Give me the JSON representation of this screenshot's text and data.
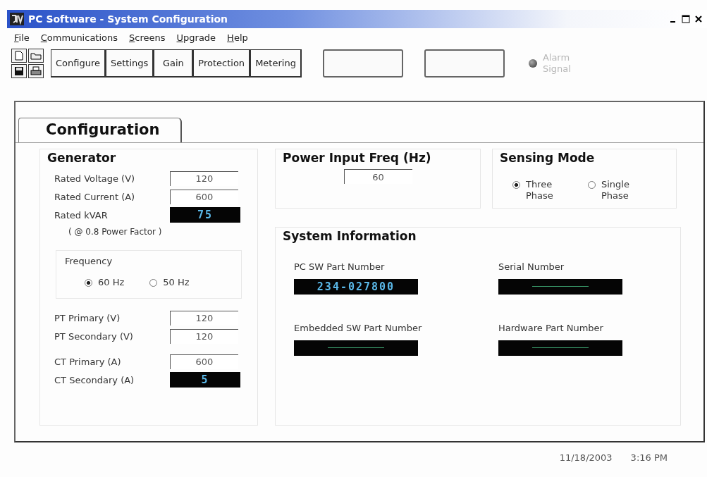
{
  "window": {
    "title": "PC Software - System Configuration"
  },
  "menu": [
    "File",
    "Communications",
    "Screens",
    "Upgrade",
    "Help"
  ],
  "nav_buttons": [
    "Configure",
    "Settings",
    "Gain",
    "Protection",
    "Metering"
  ],
  "action_buttons": [
    {
      "disabled": true
    },
    {
      "disabled": true
    }
  ],
  "alarm": {
    "label": "Alarm Signal",
    "disabled": true
  },
  "tab": {
    "label": "Configuration",
    "selected": true
  },
  "generator": {
    "title": "Generator",
    "fields": [
      {
        "label": "Rated Voltage (V)",
        "value": "120",
        "kind": "input"
      },
      {
        "label": "Rated Current (A)",
        "value": "600",
        "kind": "input"
      },
      {
        "label": "Rated kVAR",
        "value": "75",
        "kind": "display"
      }
    ],
    "note": "( @ 0.8 Power Factor )",
    "frequency": {
      "title": "Frequency",
      "options": [
        {
          "label": "60 Hz",
          "selected": true
        },
        {
          "label": "50 Hz",
          "selected": false
        }
      ]
    },
    "transformer_groups": [
      [
        {
          "label": "PT Primary (V)",
          "value": "120",
          "kind": "input"
        },
        {
          "label": "PT Secondary (V)",
          "value": "120",
          "kind": "input"
        }
      ],
      [
        {
          "label": "CT Primary (A)",
          "value": "600",
          "kind": "input"
        },
        {
          "label": "CT Secondary (A)",
          "value": "5",
          "kind": "display"
        }
      ]
    ]
  },
  "power_input": {
    "title": "Power Input Freq (Hz)",
    "value": "60"
  },
  "sensing_mode": {
    "title": "Sensing Mode",
    "options": [
      {
        "label": "Three Phase",
        "selected": true
      },
      {
        "label": "Single Phase",
        "selected": false
      }
    ]
  },
  "system_information": {
    "title": "System Information",
    "items": [
      {
        "label": "PC SW Part Number",
        "value": "234-027800"
      },
      {
        "label": "Serial Number"
      },
      {
        "label": "Embedded SW Part Number"
      },
      {
        "label": "Hardware Part Number"
      }
    ]
  },
  "status_bar": {
    "date": "11/18/2003",
    "time": "3:16 PM"
  }
}
